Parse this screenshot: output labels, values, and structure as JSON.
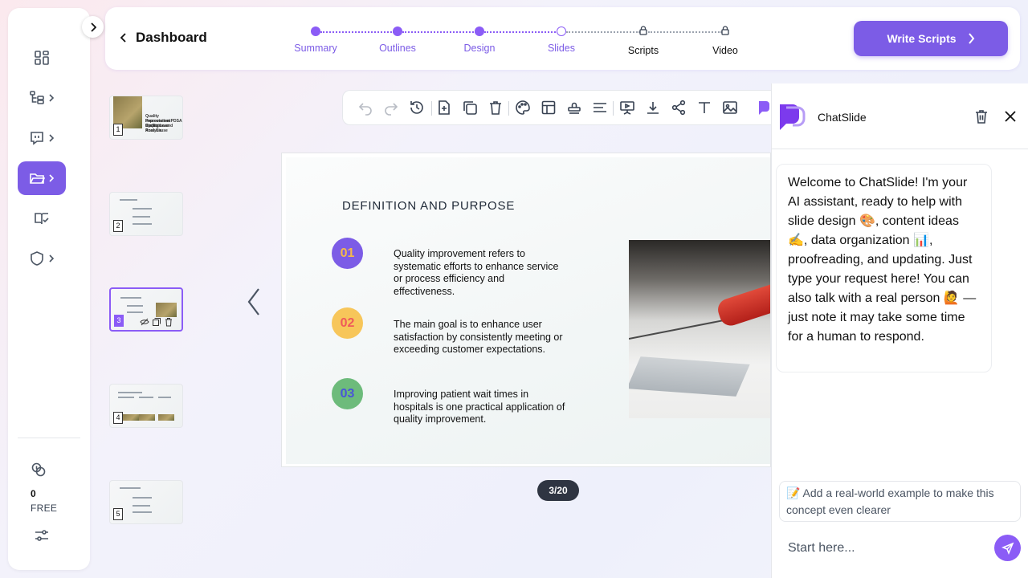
{
  "header": {
    "back_label": "Dashboard",
    "steps": [
      {
        "label": "Summary",
        "state": "done"
      },
      {
        "label": "Outlines",
        "state": "done"
      },
      {
        "label": "Design",
        "state": "done"
      },
      {
        "label": "Slides",
        "state": "current"
      },
      {
        "label": "Scripts",
        "state": "locked"
      },
      {
        "label": "Video",
        "state": "locked"
      }
    ],
    "write_button_label": "Write Scripts"
  },
  "sidebar": {
    "items": [
      {
        "icon": "grid-icon"
      },
      {
        "icon": "outline-tree-icon"
      },
      {
        "icon": "chat-bubble-icon"
      },
      {
        "icon": "folder-icon",
        "active": true
      },
      {
        "icon": "book-check-icon"
      },
      {
        "icon": "shield-icon"
      }
    ],
    "credits_count": "0",
    "plan_label": "FREE",
    "accent_color": "#7c5ce6"
  },
  "thumbnails": [
    {
      "number": "1",
      "lines": [
        "Quality Improvement Project",
        "Presentation PDSA Cycles Lean",
        "Six Sigma and Root Cause",
        "Analysis"
      ]
    },
    {
      "number": "2"
    },
    {
      "number": "3",
      "selected": true
    },
    {
      "number": "4"
    },
    {
      "number": "5"
    }
  ],
  "slide": {
    "title": "DEFINITION AND PURPOSE",
    "points": [
      {
        "number": "01",
        "text": "Quality improvement refers to systematic efforts to enhance service or process efficiency and effectiveness.",
        "circle_color": "#7c5ce6",
        "number_color": "#f5b94a"
      },
      {
        "number": "02",
        "text": "The main goal is to enhance user satisfaction by consistently meeting or exceeding customer expectations.",
        "circle_color": "#f7c65a",
        "number_color": "#ef5a5a"
      },
      {
        "number": "03",
        "text": "Improving patient wait times in hospitals is one practical application of quality improvement.",
        "circle_color": "#6dbb7b",
        "number_color": "#4a55d8"
      }
    ],
    "page_indicator": "3/20"
  },
  "chat": {
    "name": "ChatSlide",
    "welcome": "Welcome to ChatSlide! I'm your AI assistant, ready to help with slide design 🎨, content ideas ✍️, data organization 📊, proofreading, and updating. Just type your request here! You can also talk with a real person 🙋 — just note it may take some time for a human to respond.",
    "suggestion": "📝 Add a real-world example to make this concept even clearer",
    "input_placeholder": "Start here..."
  }
}
